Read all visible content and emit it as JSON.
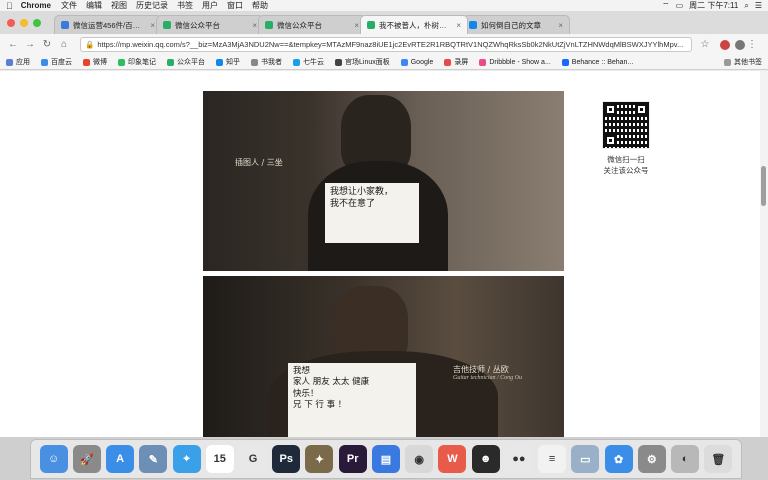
{
  "menubar": {
    "app_name": "Chrome",
    "menus": [
      "文件",
      "编辑",
      "视图",
      "历史记录",
      "书签",
      "用户",
      "窗口",
      "帮助"
    ],
    "clock": "周二 下午7:11"
  },
  "tabs": [
    {
      "label": "微信运营456件/百度脑图",
      "active": false
    },
    {
      "label": "微信公众平台",
      "active": false
    },
    {
      "label": "微信公众平台",
      "active": false
    },
    {
      "label": "我不被普人，朴树推荐的电影",
      "active": true
    },
    {
      "label": "如何倒自己的文章",
      "active": false
    }
  ],
  "toolbar": {
    "url": "https://mp.weixin.qq.com/s?__biz=MzA3MjA3NDU2Nw==&tempkey=MTAzMF9naz8iUE1jc2EvRTE2R1RBQTRtV1NQZWhqRksSb0k2NkUtZjVnLTZHNWdqMlBSWXJYYlhMpv..."
  },
  "bookmarks": [
    {
      "label": "应用",
      "color": "#5a7fd6"
    },
    {
      "label": "百度云",
      "color": "#3a8ee6"
    },
    {
      "label": "微博",
      "color": "#e6452b"
    },
    {
      "label": "印象笔记",
      "color": "#2dbe60"
    },
    {
      "label": "公众平台",
      "color": "#2aae67"
    },
    {
      "label": "知乎",
      "color": "#0f88eb"
    },
    {
      "label": "书我者",
      "color": "#888888"
    },
    {
      "label": "七牛云",
      "color": "#19a0e6"
    },
    {
      "label": "官场Linux面板",
      "color": "#444444"
    },
    {
      "label": "Google",
      "color": "#4285f4"
    },
    {
      "label": "录屏",
      "color": "#e64a4a"
    },
    {
      "label": "Dribbble - Show a...",
      "color": "#ea4c89"
    },
    {
      "label": "Behance :: Behan...",
      "color": "#1769ff"
    }
  ],
  "bookmarks_other": "其他书签",
  "article": {
    "photo1": {
      "caption": "插图人 / 三坐",
      "caption_sub": "",
      "sign_lines": [
        "我想让小家教，",
        "我不在意了"
      ]
    },
    "photo2": {
      "caption": "吉他技师 / 丛欧",
      "caption_sub": "Guitar technician / Cong Ou",
      "sign_lines": [
        "我想",
        "家人 朋友 太太 健康",
        "快乐！",
        "兄 下 行 事 ！"
      ]
    }
  },
  "qr_panel": {
    "line1": "微信扫一扫",
    "line2": "关注该公众号"
  },
  "dock": [
    {
      "name": "finder",
      "color": "#4a90e2",
      "glyph": "☺"
    },
    {
      "name": "launchpad",
      "color": "#8a8a8a",
      "glyph": "🚀"
    },
    {
      "name": "app-store",
      "color": "#3b8ee8",
      "glyph": "A"
    },
    {
      "name": "preview",
      "color": "#6d8fb5",
      "glyph": "✎"
    },
    {
      "name": "safari",
      "color": "#3aa0e8",
      "glyph": "⌖"
    },
    {
      "name": "calendar",
      "color": "#ffffff",
      "glyph": "15"
    },
    {
      "name": "app-g",
      "color": "#e8e8e8",
      "glyph": "G"
    },
    {
      "name": "photoshop",
      "color": "#1e2a3a",
      "glyph": "Ps"
    },
    {
      "name": "cheetah",
      "color": "#7a6a4a",
      "glyph": "✦"
    },
    {
      "name": "premiere",
      "color": "#2a1a3a",
      "glyph": "Pr"
    },
    {
      "name": "keynote",
      "color": "#3a7ae0",
      "glyph": "▤"
    },
    {
      "name": "chrome",
      "color": "#d8d8d8",
      "glyph": "◉"
    },
    {
      "name": "wps",
      "color": "#e85a4a",
      "glyph": "W"
    },
    {
      "name": "qq",
      "color": "#2a2a2a",
      "glyph": "☻"
    },
    {
      "name": "wechat",
      "color": "#e8e8e8",
      "glyph": "●●"
    },
    {
      "name": "notes",
      "color": "#f2f2f2",
      "glyph": "≡"
    },
    {
      "name": "stack",
      "color": "#9ab0c8",
      "glyph": "▭"
    },
    {
      "name": "photos",
      "color": "#3a8ee8",
      "glyph": "✿"
    },
    {
      "name": "system-prefs",
      "color": "#8a8a8a",
      "glyph": "⚙"
    },
    {
      "name": "disk-utility",
      "color": "#b8b8b8",
      "glyph": "◐"
    },
    {
      "name": "trash",
      "color": "#dcdcdc",
      "glyph": "🗑"
    }
  ]
}
